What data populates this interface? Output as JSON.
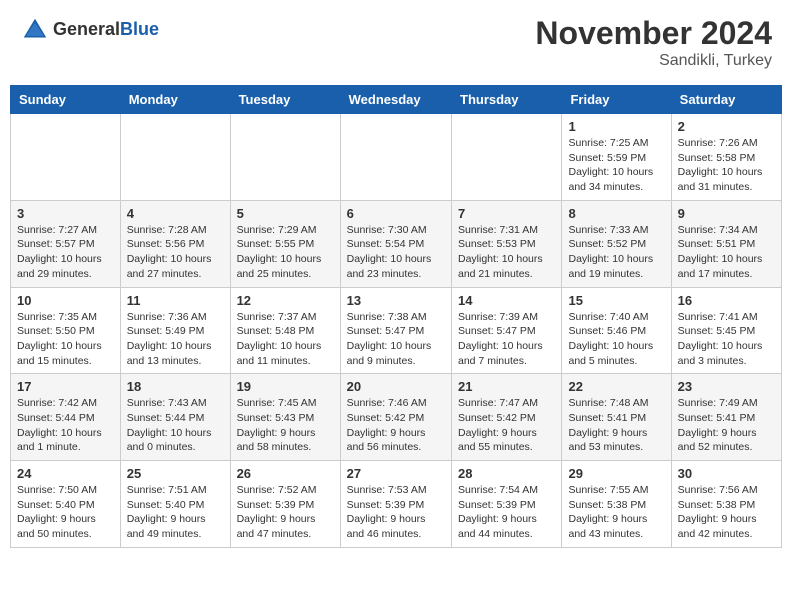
{
  "header": {
    "logo_line1": "General",
    "logo_line2": "Blue",
    "month": "November 2024",
    "location": "Sandikli, Turkey"
  },
  "weekdays": [
    "Sunday",
    "Monday",
    "Tuesday",
    "Wednesday",
    "Thursday",
    "Friday",
    "Saturday"
  ],
  "weeks": [
    [
      {
        "day": "",
        "info": ""
      },
      {
        "day": "",
        "info": ""
      },
      {
        "day": "",
        "info": ""
      },
      {
        "day": "",
        "info": ""
      },
      {
        "day": "",
        "info": ""
      },
      {
        "day": "1",
        "info": "Sunrise: 7:25 AM\nSunset: 5:59 PM\nDaylight: 10 hours and 34 minutes."
      },
      {
        "day": "2",
        "info": "Sunrise: 7:26 AM\nSunset: 5:58 PM\nDaylight: 10 hours and 31 minutes."
      }
    ],
    [
      {
        "day": "3",
        "info": "Sunrise: 7:27 AM\nSunset: 5:57 PM\nDaylight: 10 hours and 29 minutes."
      },
      {
        "day": "4",
        "info": "Sunrise: 7:28 AM\nSunset: 5:56 PM\nDaylight: 10 hours and 27 minutes."
      },
      {
        "day": "5",
        "info": "Sunrise: 7:29 AM\nSunset: 5:55 PM\nDaylight: 10 hours and 25 minutes."
      },
      {
        "day": "6",
        "info": "Sunrise: 7:30 AM\nSunset: 5:54 PM\nDaylight: 10 hours and 23 minutes."
      },
      {
        "day": "7",
        "info": "Sunrise: 7:31 AM\nSunset: 5:53 PM\nDaylight: 10 hours and 21 minutes."
      },
      {
        "day": "8",
        "info": "Sunrise: 7:33 AM\nSunset: 5:52 PM\nDaylight: 10 hours and 19 minutes."
      },
      {
        "day": "9",
        "info": "Sunrise: 7:34 AM\nSunset: 5:51 PM\nDaylight: 10 hours and 17 minutes."
      }
    ],
    [
      {
        "day": "10",
        "info": "Sunrise: 7:35 AM\nSunset: 5:50 PM\nDaylight: 10 hours and 15 minutes."
      },
      {
        "day": "11",
        "info": "Sunrise: 7:36 AM\nSunset: 5:49 PM\nDaylight: 10 hours and 13 minutes."
      },
      {
        "day": "12",
        "info": "Sunrise: 7:37 AM\nSunset: 5:48 PM\nDaylight: 10 hours and 11 minutes."
      },
      {
        "day": "13",
        "info": "Sunrise: 7:38 AM\nSunset: 5:47 PM\nDaylight: 10 hours and 9 minutes."
      },
      {
        "day": "14",
        "info": "Sunrise: 7:39 AM\nSunset: 5:47 PM\nDaylight: 10 hours and 7 minutes."
      },
      {
        "day": "15",
        "info": "Sunrise: 7:40 AM\nSunset: 5:46 PM\nDaylight: 10 hours and 5 minutes."
      },
      {
        "day": "16",
        "info": "Sunrise: 7:41 AM\nSunset: 5:45 PM\nDaylight: 10 hours and 3 minutes."
      }
    ],
    [
      {
        "day": "17",
        "info": "Sunrise: 7:42 AM\nSunset: 5:44 PM\nDaylight: 10 hours and 1 minute."
      },
      {
        "day": "18",
        "info": "Sunrise: 7:43 AM\nSunset: 5:44 PM\nDaylight: 10 hours and 0 minutes."
      },
      {
        "day": "19",
        "info": "Sunrise: 7:45 AM\nSunset: 5:43 PM\nDaylight: 9 hours and 58 minutes."
      },
      {
        "day": "20",
        "info": "Sunrise: 7:46 AM\nSunset: 5:42 PM\nDaylight: 9 hours and 56 minutes."
      },
      {
        "day": "21",
        "info": "Sunrise: 7:47 AM\nSunset: 5:42 PM\nDaylight: 9 hours and 55 minutes."
      },
      {
        "day": "22",
        "info": "Sunrise: 7:48 AM\nSunset: 5:41 PM\nDaylight: 9 hours and 53 minutes."
      },
      {
        "day": "23",
        "info": "Sunrise: 7:49 AM\nSunset: 5:41 PM\nDaylight: 9 hours and 52 minutes."
      }
    ],
    [
      {
        "day": "24",
        "info": "Sunrise: 7:50 AM\nSunset: 5:40 PM\nDaylight: 9 hours and 50 minutes."
      },
      {
        "day": "25",
        "info": "Sunrise: 7:51 AM\nSunset: 5:40 PM\nDaylight: 9 hours and 49 minutes."
      },
      {
        "day": "26",
        "info": "Sunrise: 7:52 AM\nSunset: 5:39 PM\nDaylight: 9 hours and 47 minutes."
      },
      {
        "day": "27",
        "info": "Sunrise: 7:53 AM\nSunset: 5:39 PM\nDaylight: 9 hours and 46 minutes."
      },
      {
        "day": "28",
        "info": "Sunrise: 7:54 AM\nSunset: 5:39 PM\nDaylight: 9 hours and 44 minutes."
      },
      {
        "day": "29",
        "info": "Sunrise: 7:55 AM\nSunset: 5:38 PM\nDaylight: 9 hours and 43 minutes."
      },
      {
        "day": "30",
        "info": "Sunrise: 7:56 AM\nSunset: 5:38 PM\nDaylight: 9 hours and 42 minutes."
      }
    ]
  ]
}
